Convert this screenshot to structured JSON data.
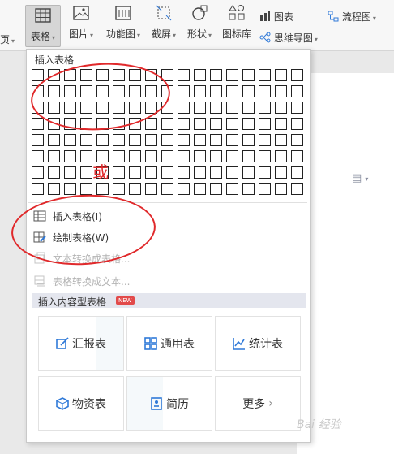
{
  "ribbon": {
    "left_partial": "页",
    "table": "表格",
    "picture": "图片",
    "function_chart": "功能图",
    "screenshot": "截屏",
    "shape": "形状",
    "icon_library": "图标库",
    "chart": "图表",
    "mind_map": "思维导图",
    "flowchart": "流程图"
  },
  "dropdown": {
    "insert_table_title": "插入表格",
    "grid": {
      "columns": 17,
      "rows": 8
    },
    "menu": [
      {
        "label": "插入表格(I)",
        "enabled": true,
        "icon": "table-insert-icon"
      },
      {
        "label": "绘制表格(W)",
        "enabled": true,
        "icon": "pencil-table-icon"
      },
      {
        "label": "文本转换成表格...",
        "enabled": false,
        "icon": "text-to-table-icon"
      },
      {
        "label": "表格转换成文本...",
        "enabled": false,
        "icon": "table-to-text-icon"
      }
    ],
    "content_section_title": "插入内容型表格",
    "badge": "NEW",
    "cards": [
      {
        "label": "汇报表",
        "icon": "report-icon"
      },
      {
        "label": "通用表",
        "icon": "grid-icon"
      },
      {
        "label": "统计表",
        "icon": "line-chart-icon"
      },
      {
        "label": "物资表",
        "icon": "box-icon"
      },
      {
        "label": "简历",
        "icon": "resume-icon"
      },
      {
        "label": "更多",
        "icon": "chevron-right-icon"
      }
    ]
  },
  "annotation": {
    "or_text": "或"
  },
  "watermark": "Bai 经验",
  "colors": {
    "annotation_red": "#e0292b",
    "icon_blue": "#2f79d8",
    "badge_red": "#e24a4a"
  }
}
